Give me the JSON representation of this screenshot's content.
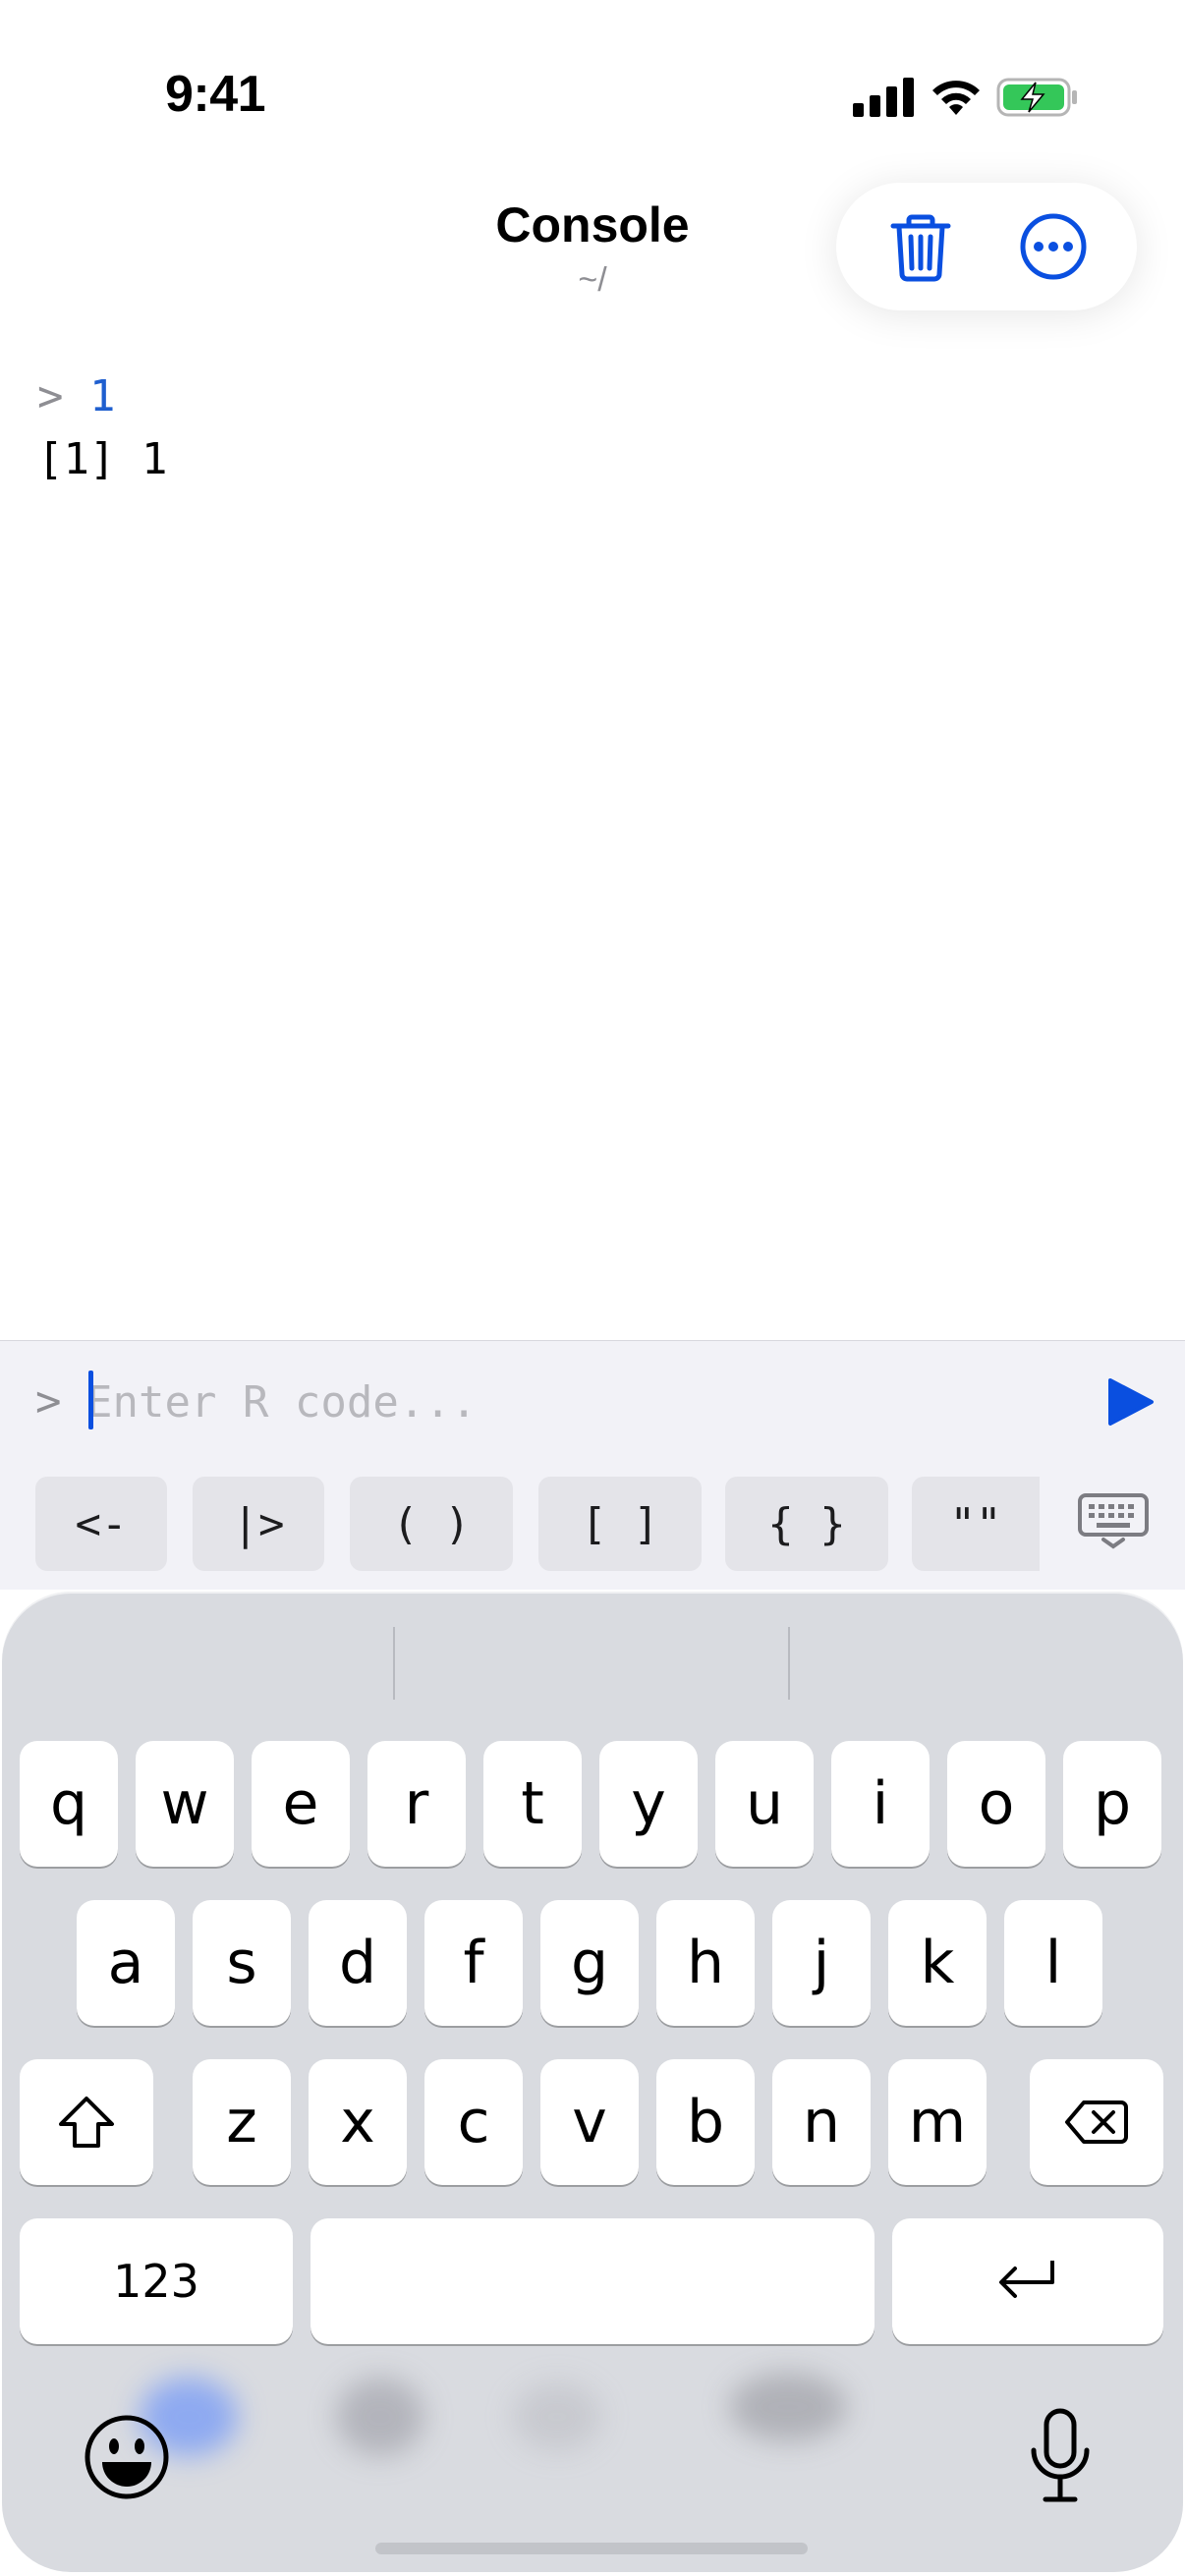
{
  "status_bar": {
    "time": "9:41"
  },
  "nav": {
    "title": "Console",
    "subtitle": "~/"
  },
  "console": {
    "lines": [
      {
        "prompt": ">",
        "code": "1"
      },
      {
        "output": "[1] 1"
      }
    ]
  },
  "input": {
    "prompt": ">",
    "placeholder": "Enter R code...",
    "value": ""
  },
  "shortcuts": [
    "<-",
    "|>",
    "( )",
    "[ ]",
    "{ }",
    "\"\""
  ],
  "keyboard": {
    "row1": [
      "q",
      "w",
      "e",
      "r",
      "t",
      "y",
      "u",
      "i",
      "o",
      "p"
    ],
    "row2": [
      "a",
      "s",
      "d",
      "f",
      "g",
      "h",
      "j",
      "k",
      "l"
    ],
    "row3": [
      "z",
      "x",
      "c",
      "v",
      "b",
      "n",
      "m"
    ],
    "numbers_key": "123"
  },
  "colors": {
    "accent": "#0a4fe0",
    "code_blue": "#1f5fcf",
    "battery_green": "#34c759"
  }
}
